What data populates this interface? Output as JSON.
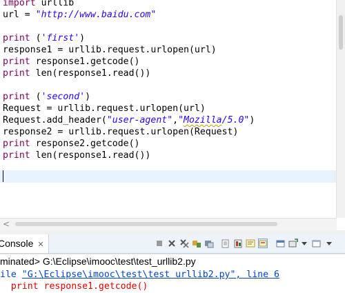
{
  "editor": {
    "lines": [
      [
        {
          "t": "import",
          "c": "kw"
        },
        {
          "t": " urllib",
          "c": ""
        }
      ],
      [
        {
          "t": "url = ",
          "c": ""
        },
        {
          "t": "\"http://www.baidu.com\"",
          "c": "str"
        }
      ],
      [],
      [
        {
          "t": "print",
          "c": "kw"
        },
        {
          "t": " (",
          "c": ""
        },
        {
          "t": "'first'",
          "c": "str"
        },
        {
          "t": ")",
          "c": ""
        }
      ],
      [
        {
          "t": "response1 = urllib.request.urlopen(url)",
          "c": ""
        }
      ],
      [
        {
          "t": "print",
          "c": "kw"
        },
        {
          "t": " response1.getcode()",
          "c": ""
        }
      ],
      [
        {
          "t": "print",
          "c": "kw"
        },
        {
          "t": " len(response1.read())",
          "c": ""
        }
      ],
      [],
      [
        {
          "t": "print",
          "c": "kw"
        },
        {
          "t": " (",
          "c": ""
        },
        {
          "t": "'second'",
          "c": "str"
        },
        {
          "t": ")",
          "c": ""
        }
      ],
      [
        {
          "t": "Request = urllib.request.urlopen(url)",
          "c": ""
        }
      ],
      [
        {
          "t": "Request.add_header(",
          "c": ""
        },
        {
          "t": "\"user-agent\"",
          "c": "str"
        },
        {
          "t": ",",
          "c": ""
        },
        {
          "t": "\"",
          "c": "str"
        },
        {
          "t": "Mozilla",
          "c": "str squig"
        },
        {
          "t": "/5.0\"",
          "c": "str"
        },
        {
          "t": ")",
          "c": ""
        }
      ],
      [
        {
          "t": "response2 = urllib.request.urlopen(Request)",
          "c": ""
        }
      ],
      [
        {
          "t": "print",
          "c": "kw"
        },
        {
          "t": " response2.getcode()",
          "c": ""
        }
      ],
      [
        {
          "t": "print",
          "c": "kw"
        },
        {
          "t": " len(response1.read())",
          "c": ""
        }
      ]
    ]
  },
  "console": {
    "tab_label": "Console",
    "close_glyph": "✕",
    "terminated_text": "minated> G:\\Eclipse\\imooc\\test\\test_urllib2.py",
    "trace_prefix": "ile ",
    "trace_link": "\"G:\\Eclipse\\imooc\\test\\test urllib2.py\", line 6",
    "trace_code": "  print response1.getcode()"
  },
  "toolbar_icons": [
    "terminate-icon",
    "remove-launch-icon",
    "remove-all-icon",
    "word-wrap-icon",
    "scroll-lock-icon",
    "clear-console-icon",
    "pin-console-icon",
    "show-stdout-icon",
    "show-stderr-icon",
    "open-console-icon",
    "console-menu-icon",
    "new-console-icon",
    "view-menu-icon"
  ],
  "colors": {
    "keyword": "#7f0055",
    "string": "#2a00ff",
    "current_line": "#e8f2fe",
    "link": "#0044c8",
    "error": "#e00000"
  }
}
